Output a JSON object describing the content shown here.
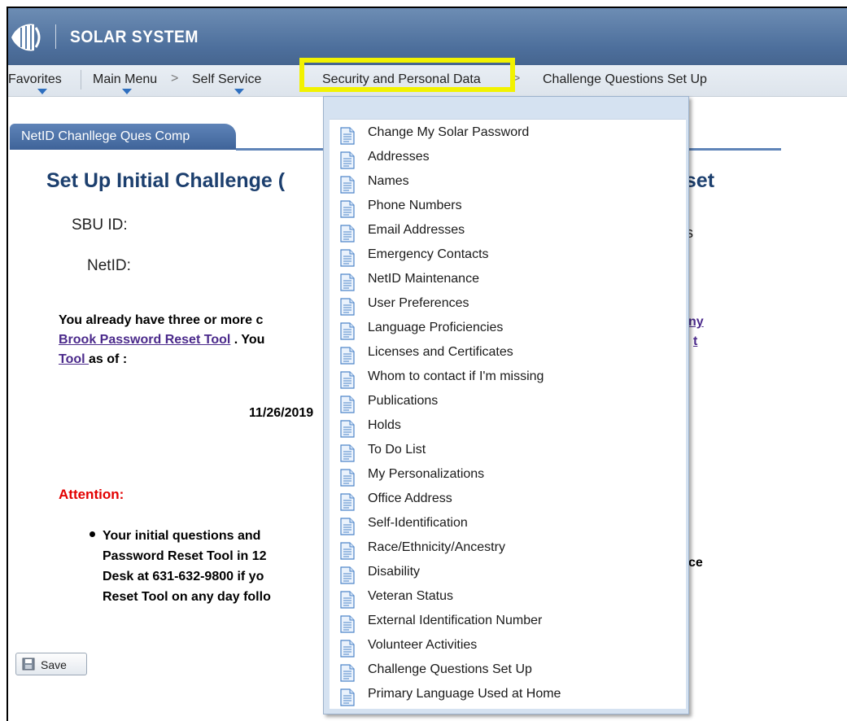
{
  "header": {
    "app_title": "SOLAR SYSTEM",
    "logo_icon": "stony-brook-logo-icon"
  },
  "nav": {
    "favorites": "Favorites",
    "main_menu": "Main Menu",
    "self_service": "Self Service",
    "security": "Security and Personal Data",
    "current": "Challenge Questions Set Up",
    "separator": ">"
  },
  "tab": {
    "label": "NetID Chanllege Ques Comp"
  },
  "page": {
    "title": "Set Up Initial Challenge (",
    "title_tail": "eset",
    "sbu_label": "SBU ID:",
    "netid_label": "NetID:",
    "s_tail": "s",
    "para_line1": "You already have three or more c",
    "link1": "Brook Password Reset Tool",
    "para_line2": ". You",
    "link2": "Tool ",
    "para_line3": "as of :",
    "link_tail1": "ny",
    "link_tail2": "t",
    "date": "11/26/2019",
    "attention": "Attention:",
    "bullet_lines": [
      "Your initial questions and",
      "Password Reset Tool in 12",
      "Desk at 631-632-9800 if yo",
      "Reset Tool on any day follo"
    ],
    "ce_tail": "ce"
  },
  "save_button": {
    "label": "Save",
    "icon": "floppy-disk-icon"
  },
  "dropdown": {
    "items": [
      "Change My Solar Password",
      "Addresses",
      "Names",
      "Phone Numbers",
      "Email Addresses",
      "Emergency Contacts",
      "NetID Maintenance",
      "User Preferences",
      "Language Proficiencies",
      "Licenses and Certificates",
      "Whom to contact if I'm missing",
      "Publications",
      "Holds",
      "To Do List",
      "My Personalizations",
      "Office Address",
      "Self-Identification",
      "Race/Ethnicity/Ancestry",
      "Disability",
      "Veteran Status",
      "External Identification Number",
      "Volunteer Activities",
      "Challenge Questions Set Up",
      "Primary Language Used at Home"
    ],
    "item_icon": "document-icon"
  },
  "colors": {
    "header": "#4d6f9c",
    "title": "#1c3f6e",
    "attention": "#e30000",
    "highlight": "#f2f200",
    "link": "#4b2a8b"
  }
}
